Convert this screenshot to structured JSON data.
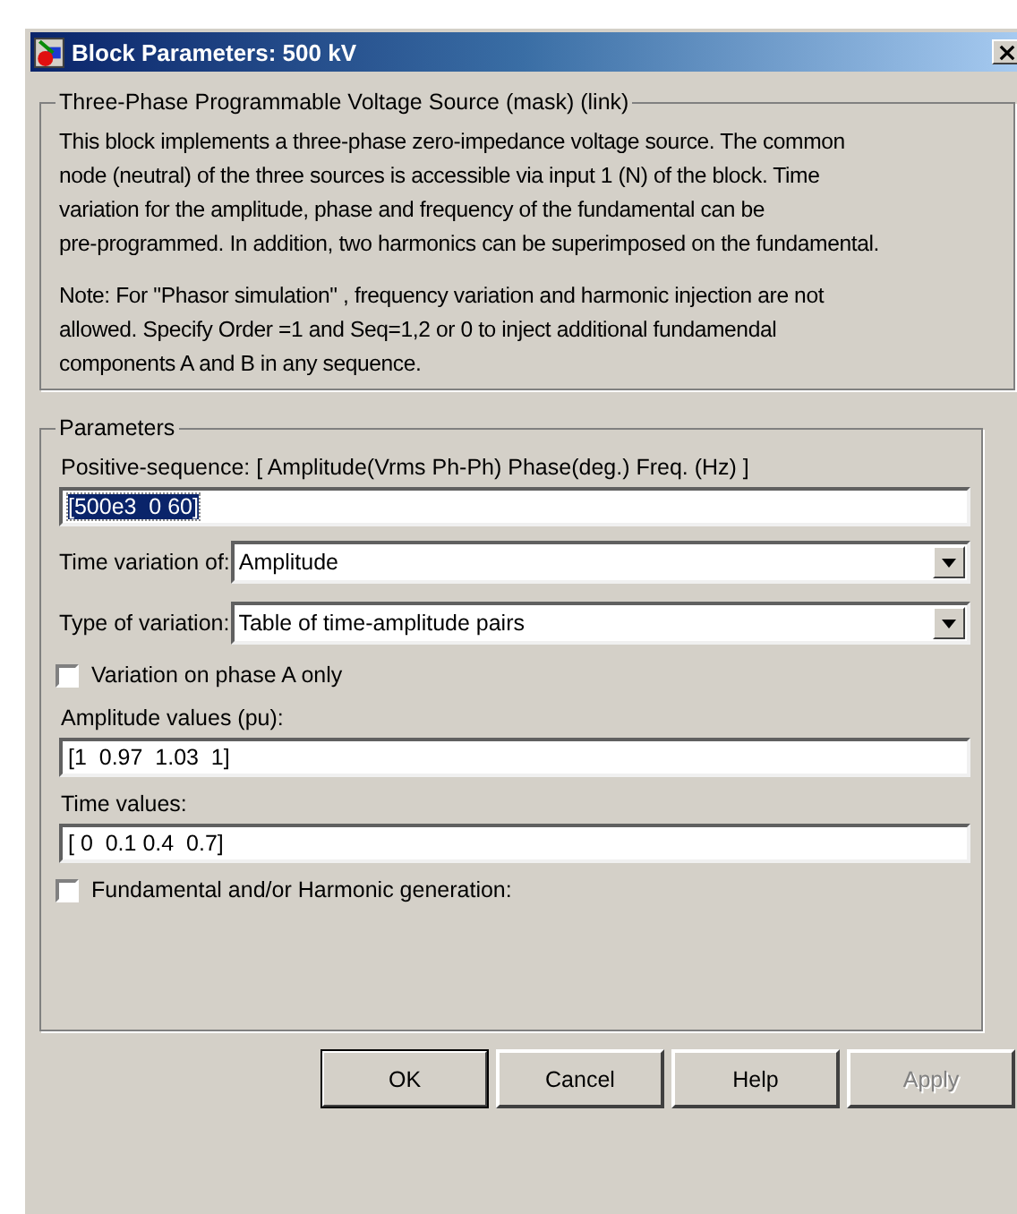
{
  "window": {
    "title": "Block Parameters: 500 kV"
  },
  "description": {
    "title": "Three-Phase Programmable Voltage Source (mask) (link)",
    "paragraphs": [
      "This block implements a three-phase zero-impedance voltage source. The common\nnode (neutral) of the three sources is accessible via input 1 (N) of the block. Time\nvariation for the amplitude, phase and frequency of the fundamental can be\npre-programmed. In addition, two harmonics can be superimposed on the fundamental.",
      "Note: For  \"Phasor simulation\" , frequency variation and harmonic injection are not\nallowed.  Specify  Order =1 and Seq=1,2 or 0 to inject additional fundamendal\ncomponents A and B in  any sequence."
    ]
  },
  "parameters": {
    "title": "Parameters",
    "items": [
      {
        "kind": "text",
        "label": "Positive-sequence: [ Amplitude(Vrms Ph-Ph)  Phase(deg.)   Freq. (Hz) ]",
        "value": "[500e3  0 60]",
        "selected": true
      },
      {
        "kind": "dropdown",
        "label": "Time variation of:",
        "value": "Amplitude"
      },
      {
        "kind": "dropdown",
        "label": "Type of variation:",
        "value": "Table of time-amplitude pairs"
      },
      {
        "kind": "checkbox",
        "label": "Variation on phase A only",
        "checked": false
      },
      {
        "kind": "text",
        "label": "Amplitude values (pu):",
        "value": "[1  0.97  1.03  1]",
        "selected": false
      },
      {
        "kind": "text",
        "label": "Time values:",
        "value": "[ 0  0.1 0.4  0.7]",
        "selected": false
      },
      {
        "kind": "checkbox",
        "label": "Fundamental and/or Harmonic generation:",
        "checked": false
      }
    ]
  },
  "buttons": [
    {
      "label": "OK",
      "disabled": false
    },
    {
      "label": "Cancel",
      "disabled": false
    },
    {
      "label": "Help",
      "disabled": false
    },
    {
      "label": "Apply",
      "disabled": true
    }
  ]
}
